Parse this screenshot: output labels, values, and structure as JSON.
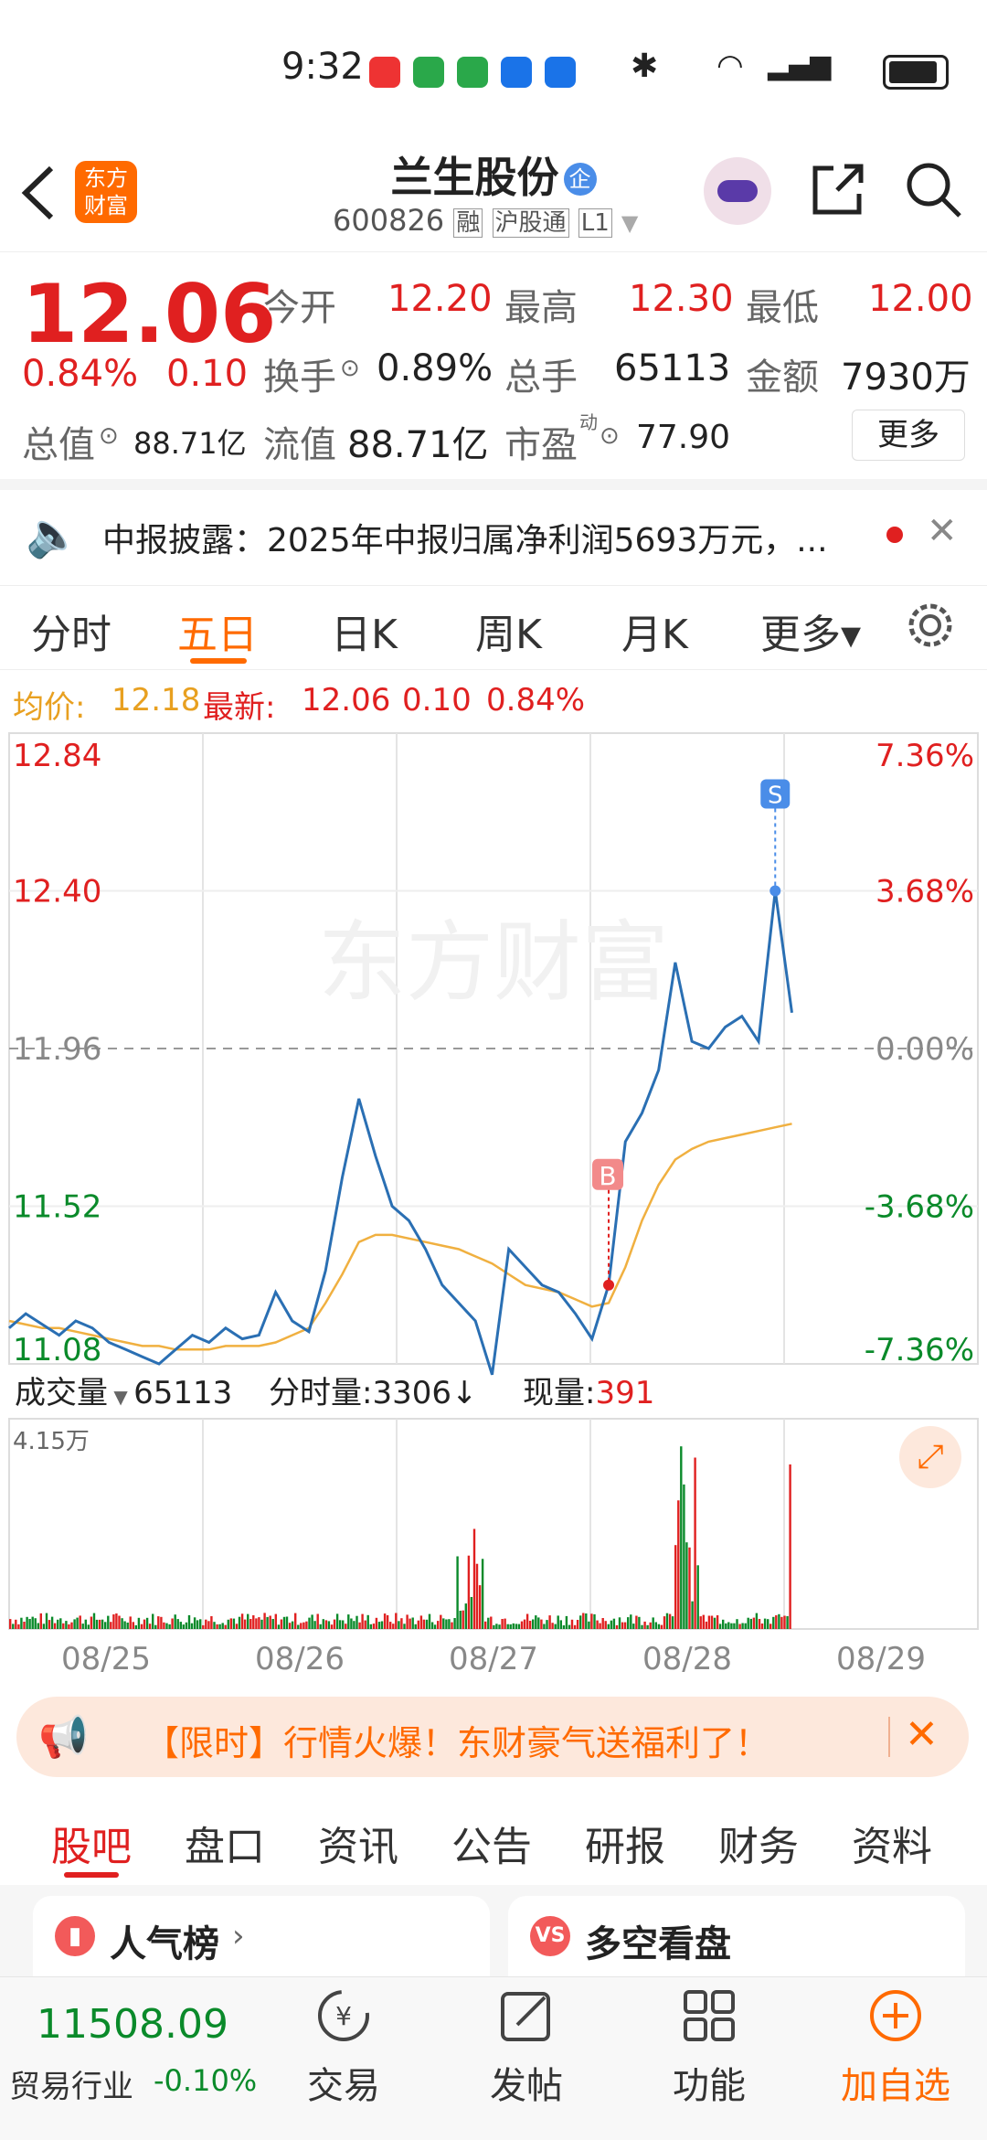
{
  "status_bar": {
    "time": "9:32"
  },
  "header": {
    "logo_line1": "东方",
    "logo_line2": "财富",
    "stock_name": "兰生股份",
    "badge": "企",
    "code": "600826",
    "tag_margin": "融",
    "tag_connect": "沪股通",
    "tag_level": "L1"
  },
  "quote": {
    "price": "12.06",
    "change_pct": "0.84%",
    "change": "0.10",
    "open_label": "今开",
    "open": "12.20",
    "high_label": "最高",
    "high": "12.30",
    "low_label": "最低",
    "low": "12.00",
    "turnover_label": "换手",
    "turnover": "0.89%",
    "volume_label": "总手",
    "volume": "65113",
    "amount_label": "金额",
    "amount": "7930万",
    "mktcap_label": "总值",
    "mktcap": "88.71亿",
    "float_label": "流值",
    "float": "88.71亿",
    "pe_label": "市盈",
    "pe_sup": "动",
    "pe": "77.90",
    "more": "更多"
  },
  "news": {
    "text": "中报披露：2025年中报归属净利润5693万元，..."
  },
  "tabs": [
    "分时",
    "五日",
    "日K",
    "周K",
    "月K",
    "更多▾"
  ],
  "active_tab": "五日",
  "avg_line": {
    "avg_label": "均价:",
    "avg": "12.18",
    "latest_label": "最新:",
    "latest": "12.06",
    "chg": "0.10",
    "pct": "0.84%"
  },
  "chart_data": {
    "type": "line",
    "title": "",
    "x": [
      "08/25",
      "08/26",
      "08/27",
      "08/28",
      "08/29"
    ],
    "y_ticks_left": [
      "12.84",
      "12.40",
      "11.96",
      "11.52",
      "11.08"
    ],
    "y_ticks_right": [
      "7.36%",
      "3.68%",
      "0.00%",
      "-3.68%",
      "-7.36%"
    ],
    "ylim": [
      11.08,
      12.84
    ],
    "prev_close": 11.96,
    "series": [
      {
        "values": [
          11.18,
          11.22,
          11.19,
          11.16,
          11.2,
          11.18,
          11.14,
          11.12,
          11.1,
          11.08,
          11.12,
          11.16,
          11.14,
          11.18,
          11.15,
          11.16,
          11.28,
          11.2,
          11.17,
          11.34,
          11.6,
          11.82,
          11.66,
          11.52,
          11.48,
          11.4,
          11.3,
          11.25,
          11.2,
          11.05,
          11.4,
          11.35,
          11.3,
          11.28,
          11.22,
          11.15,
          11.3,
          11.7,
          11.78,
          11.9,
          12.2,
          11.98,
          11.96,
          12.02,
          12.05,
          11.98,
          12.4,
          12.06
        ]
      },
      {
        "values": [
          11.2,
          11.19,
          11.18,
          11.18,
          11.17,
          11.16,
          11.15,
          11.14,
          11.13,
          11.13,
          11.12,
          11.12,
          11.12,
          11.13,
          11.13,
          11.13,
          11.14,
          11.16,
          11.18,
          11.25,
          11.33,
          11.42,
          11.44,
          11.44,
          11.43,
          11.42,
          11.41,
          11.4,
          11.38,
          11.36,
          11.33,
          11.3,
          11.29,
          11.28,
          11.26,
          11.24,
          11.25,
          11.35,
          11.48,
          11.58,
          11.65,
          11.68,
          11.7,
          11.71,
          11.72,
          11.73,
          11.74,
          11.75
        ]
      }
    ],
    "markers": [
      {
        "label": "B"
      },
      {
        "label": "S"
      }
    ]
  },
  "volume": {
    "label": "成交量",
    "total": "65113",
    "tick_label": "分时量:3306↓",
    "now_label": "现量:",
    "now": "391",
    "ymax_label": "4.15万"
  },
  "watermark": "东方财富",
  "promo": {
    "text": "【限时】行情火爆！东财豪气送福利了！"
  },
  "subtabs": [
    "股吧",
    "盘口",
    "资讯",
    "公告",
    "研报",
    "财务",
    "资料"
  ],
  "active_subtab": "股吧",
  "cards": {
    "left": "人气榜",
    "right": "多空看盘"
  },
  "bottom": {
    "index_value": "11508.09",
    "index_name": "贸易行业",
    "index_chg": "-0.10%",
    "buttons": [
      "交易",
      "发帖",
      "功能",
      "加自选"
    ]
  },
  "colors": {
    "up": "#e02020",
    "down": "#0a8a2a",
    "accent": "#ff6a00",
    "line": "#2a6fb3",
    "avg": "#f0b040"
  }
}
